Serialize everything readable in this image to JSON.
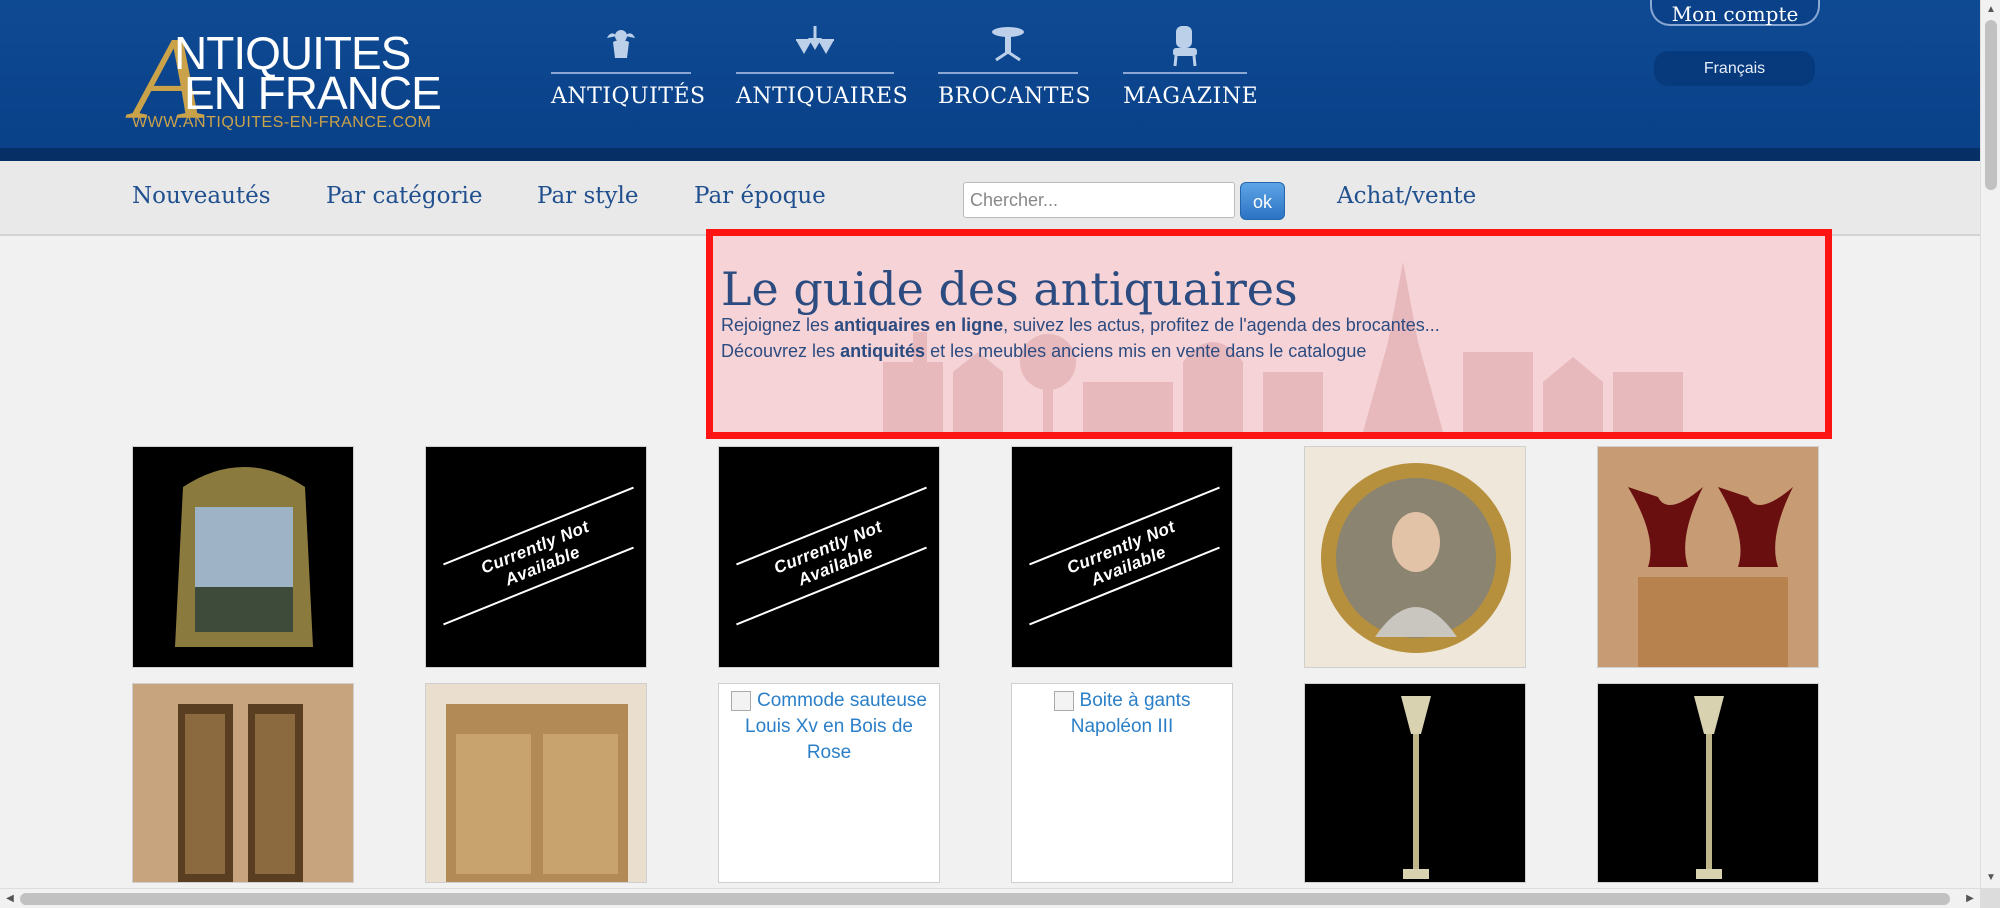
{
  "header": {
    "logo": {
      "letter": "A",
      "line1": "NTIQUITES",
      "line2": "EN FRANCE",
      "url": "WWW.ANTIQUITES-EN-FRANCE.COM"
    },
    "main_nav": [
      {
        "label": "ANTIQUITÉS",
        "icon": "cherub-icon"
      },
      {
        "label": "ANTIQUAIRES",
        "icon": "chandelier-icon"
      },
      {
        "label": "BROCANTES",
        "icon": "table-icon"
      },
      {
        "label": "MAGAZINE",
        "icon": "chair-icon"
      }
    ],
    "account_label": "Mon compte",
    "language_label": "Français"
  },
  "subnav": {
    "links": [
      "Nouveautés",
      "Par catégorie",
      "Par style",
      "Par époque"
    ],
    "search_placeholder": "Chercher...",
    "ok_label": "ok",
    "buy_sell_label": "Achat/vente"
  },
  "hero": {
    "title": "Le guide des antiquaires",
    "line1_pre": "Rejoignez les ",
    "line1_bold": "antiquaires en ligne",
    "line1_post": ", suivez les actus, profitez de l'agenda des brocantes...",
    "line2_pre": "Découvrez les ",
    "line2_bold": "antiquités",
    "line2_post": " et les meubles anciens mis en vente dans le catalogue"
  },
  "products": {
    "not_available_label": "Currently Not Available",
    "row1": [
      {
        "kind": "mirror"
      },
      {
        "kind": "unavailable"
      },
      {
        "kind": "unavailable"
      },
      {
        "kind": "unavailable"
      },
      {
        "kind": "portrait"
      },
      {
        "kind": "vases"
      }
    ],
    "row2": [
      {
        "kind": "vitrines"
      },
      {
        "kind": "cabinet"
      },
      {
        "kind": "broken",
        "alt": "Commode sauteuse Louis Xv en Bois de Rose"
      },
      {
        "kind": "broken",
        "alt": "Boite à gants Napoléon III"
      },
      {
        "kind": "lamp"
      },
      {
        "kind": "lamp"
      }
    ]
  },
  "colors": {
    "header_blue": "#0a4189",
    "gold": "#caa24a",
    "link_blue": "#21508f",
    "highlight_red": "#ff1414"
  }
}
